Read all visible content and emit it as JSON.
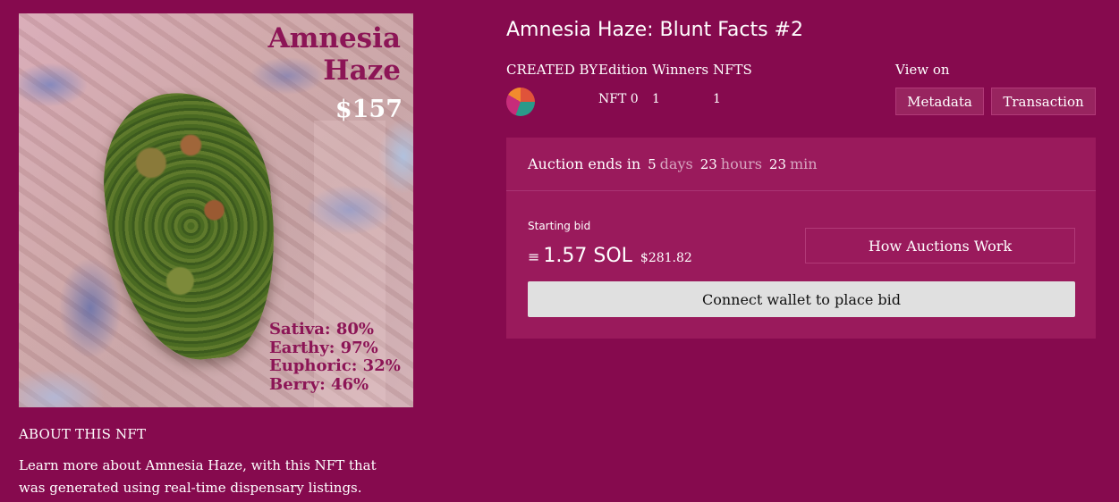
{
  "artwork": {
    "title_line1": "Amnesia",
    "title_line2": "Haze",
    "price": "$157",
    "stats": [
      "Sativa: 80%",
      "Earthy: 97%",
      "Euphoric: 32%",
      "Berry: 46%"
    ]
  },
  "about": {
    "heading": "ABOUT THIS NFT",
    "text": "Learn more about Amnesia Haze, with this NFT that was generated using real-time dispensary listings."
  },
  "header": {
    "title": "Amnesia Haze: Blunt Facts #2",
    "created_by_label": "CREATED BY",
    "edition_label": "Edition",
    "winners_label": "Winners",
    "nfts_label": "NFTS",
    "edition_value": "NFT 0",
    "winners_value": "1",
    "nfts_value": "1",
    "view_on_label": "View on",
    "metadata_label": "Metadata",
    "transaction_label": "Transaction"
  },
  "auction": {
    "ends_label": "Auction ends in",
    "days_value": "5",
    "days_unit": "days",
    "hours_value": "23",
    "hours_unit": "hours",
    "min_value": "23",
    "min_unit": "min",
    "starting_label": "Starting bid",
    "sol_icon": "≡",
    "sol_amount": "1.57 SOL",
    "usd_amount": "$281.82",
    "how_label": "How Auctions Work",
    "connect_label": "Connect wallet to place bid"
  },
  "colors": {
    "background": "#860a4e",
    "panel": "#9a1a5c",
    "accent_text": "#8c1556",
    "button_light": "#e0e0e0"
  },
  "icons": {
    "sol": "solana-icon",
    "avatar": "creator-avatar"
  }
}
